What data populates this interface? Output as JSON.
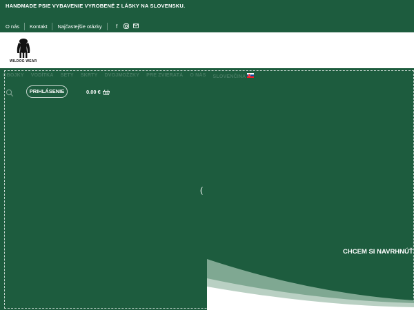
{
  "topbar": {
    "notice": "HANDMADE PSIE VYBAVENIE VYROBENÉ Z LÁSKY NA SLOVENSKU.",
    "links": [
      "O nás",
      "Kontakt",
      "Najčastejšie otázky"
    ],
    "social_icons": [
      "facebook-icon",
      "instagram-icon",
      "email-icon"
    ]
  },
  "header": {
    "logo_text": "WILDOG WEAR"
  },
  "menu": {
    "items": [
      "OBOJKY",
      "VODÍTKA",
      "SETY",
      "SKRTY",
      "DVOJMOŽZKY",
      "PRE ZVIERATÁ",
      "O NÁS",
      "SLOVENČINA"
    ],
    "language_flag": "slovakia-flag-icon"
  },
  "account": {
    "login_label": "PRIHLÁSENIE",
    "cart_total": "0.00 €"
  },
  "hero": {
    "loader_glyph": "(",
    "cta": "CHCEM SI NAVRHNÚŤ"
  },
  "colors": {
    "brand_green": "#1d5c3e",
    "header_bg": "#ffffff",
    "text": "#ffffff"
  }
}
